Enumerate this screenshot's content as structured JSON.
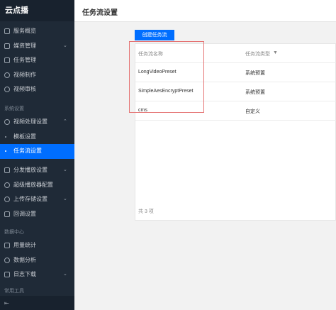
{
  "sidebar": {
    "brand": "云点播",
    "items_top": [
      {
        "label": "服务概览",
        "chevron": ""
      },
      {
        "label": "媒资管理",
        "chevron": "⌄"
      },
      {
        "label": "任务管理",
        "chevron": ""
      },
      {
        "label": "视频制作",
        "chevron": ""
      },
      {
        "label": "视频审核",
        "chevron": ""
      }
    ],
    "section_system": "系统设置",
    "video_processing": {
      "label": "视频处理设置",
      "chevron": "⌃"
    },
    "sub_items": [
      {
        "label": "模板设置"
      },
      {
        "label": "任务流设置"
      }
    ],
    "items_mid": [
      {
        "label": "分发播放设置",
        "chevron": "⌄"
      },
      {
        "label": "超级播放器配置",
        "chevron": ""
      },
      {
        "label": "上传存储设置",
        "chevron": "⌄"
      },
      {
        "label": "回调设置",
        "chevron": ""
      }
    ],
    "section_data": "数据中心",
    "items_data": [
      {
        "label": "用量统计",
        "chevron": ""
      },
      {
        "label": "数据分析",
        "chevron": ""
      },
      {
        "label": "日志下载",
        "chevron": "⌄"
      }
    ],
    "section_tools": "常用工具",
    "collapse_icon": "⇤"
  },
  "header": {
    "title": "任务流设置"
  },
  "toolbar": {
    "create_label": "创建任务流"
  },
  "table": {
    "headers": {
      "name": "任务流名称",
      "type": "任务流类型",
      "filter": "▼"
    },
    "rows": [
      {
        "name": "LongVideoPreset",
        "type": "系统预置"
      },
      {
        "name": "SimpleAesEncryptPreset",
        "type": "系统预置"
      },
      {
        "name": "cms",
        "type": "自定义"
      }
    ],
    "total": "共 3 项"
  },
  "colors": {
    "accent": "#006eff",
    "sidebar_bg": "#1f2a37",
    "highlight": "#e57373"
  }
}
